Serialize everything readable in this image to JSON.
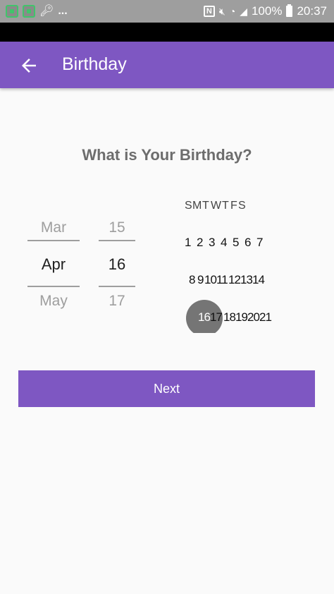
{
  "status_bar": {
    "dots": "...",
    "battery": "100%",
    "time": "20:37",
    "nfc": "N"
  },
  "app_bar": {
    "title": "Birthday"
  },
  "question": "What is Your Birthday?",
  "month_picker": {
    "prev": "Mar",
    "current": "Apr",
    "next": "May"
  },
  "day_picker": {
    "prev": "15",
    "current": "16",
    "next": "17"
  },
  "calendar": {
    "weekdays": [
      "S",
      "M",
      "T",
      "W",
      "T",
      "F",
      "S"
    ],
    "week1": [
      "1",
      "2",
      "3",
      "4",
      "5",
      "6",
      "7"
    ],
    "week2": [
      "8",
      "9",
      "10",
      "11",
      "12",
      "13",
      "14"
    ],
    "week3": [
      "16",
      "17",
      "18",
      "19",
      "20",
      "21"
    ],
    "selected_day": "16"
  },
  "next_button": "Next",
  "colors": {
    "accent": "#7e57c2",
    "status_bar": "#9e9e9e",
    "highlight": "#757575"
  }
}
